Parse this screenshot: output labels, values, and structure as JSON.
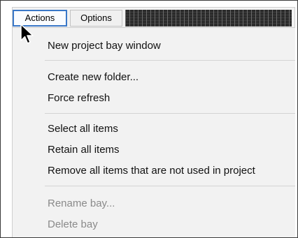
{
  "menubar": {
    "tabs": [
      {
        "label": "Actions"
      },
      {
        "label": "Options"
      }
    ]
  },
  "menu": {
    "items": [
      {
        "label": "New project bay window",
        "enabled": true
      },
      {
        "label": "Create new folder...",
        "enabled": true
      },
      {
        "label": "Force refresh",
        "enabled": true
      },
      {
        "label": "Select all items",
        "enabled": true
      },
      {
        "label": "Retain all items",
        "enabled": true
      },
      {
        "label": "Remove all items that are not used in project",
        "enabled": true
      },
      {
        "label": "Rename bay...",
        "enabled": false
      },
      {
        "label": "Delete bay",
        "enabled": false
      }
    ]
  },
  "colors": {
    "active_tab_border": "#3a78c8",
    "disabled_text": "#8a8a8a",
    "menu_background": "#f2f2f2"
  },
  "icons": {
    "cursor": "mouse-pointer-icon"
  }
}
